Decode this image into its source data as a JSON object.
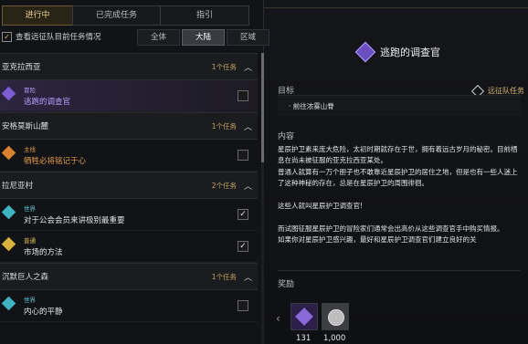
{
  "tabs": [
    {
      "label": "进行中",
      "active": true
    },
    {
      "label": "已完成任务",
      "active": false
    },
    {
      "label": "指引",
      "active": false
    }
  ],
  "option": {
    "label": "查看远征队目前任务情况",
    "checked": true,
    "mark": "✓"
  },
  "filters": [
    {
      "label": "全体",
      "active": false
    },
    {
      "label": "大陆",
      "active": true
    },
    {
      "label": "区域",
      "active": false
    }
  ],
  "regions": [
    {
      "name": "亚克拉西亚",
      "count": "1个任务",
      "chevron": "︿",
      "quests": [
        {
          "type": "冒险",
          "name": "逃跑的调查官",
          "color": "#b99cff",
          "typeColor": "#b99cff",
          "checked": false,
          "selected": true,
          "icon": "diamond-purple"
        }
      ]
    },
    {
      "name": "安格莫斯山麓",
      "count": "1个任务",
      "chevron": "︿",
      "quests": [
        {
          "type": "主线",
          "name": "牺牲必将铭记于心",
          "color": "#e39b4c",
          "typeColor": "#e39b4c",
          "checked": false,
          "selected": false,
          "icon": "diamond-orange"
        }
      ]
    },
    {
      "name": "拉尼亚村",
      "count": "2个任务",
      "chevron": "︿",
      "quests": [
        {
          "type": "世界",
          "name": "对于公会会员来讲极别最重要",
          "color": "#e2e2e2",
          "typeColor": "#63c9d6",
          "checked": true,
          "selected": false,
          "icon": "diamond-cyan"
        },
        {
          "type": "普通",
          "name": "市场的方法",
          "color": "#e2e2e2",
          "typeColor": "#e3c55a",
          "checked": true,
          "selected": false,
          "icon": "diamond-yellow"
        }
      ]
    },
    {
      "name": "沉默巨人之森",
      "count": "1个任务",
      "chevron": "︿",
      "quests": [
        {
          "type": "世界",
          "name": "内心的平静",
          "color": "#e2e2e2",
          "typeColor": "#63c9d6",
          "checked": false,
          "selected": false,
          "icon": "diamond-cyan"
        }
      ]
    }
  ],
  "detail": {
    "title": "逃跑的调查官",
    "goal_label": "目标",
    "goal_tag": "远征队任务",
    "goal_text": "· 前往浓雾山脊",
    "content_label": "内容",
    "content": [
      "星辰护卫素来庞大危险，太初时期就存在于世，拥有着远古岁月的秘密。目前栖息在尚未被征服的亚克拉西亚某处。",
      "普通人就算有一万个胆子也不敢靠近星辰护卫的居住之地，但是也有一些人迷上了这种神秘的存在，总是在星辰护卫的周围徘徊。",
      "",
      "这些人就叫星辰护卫调查官!",
      "",
      "而试图征服星辰护卫的冒险家们通常会出高价从这些调查官手中购买情报。",
      "如果你对星辰护卫感兴趣，最好和星辰护卫调查官们建立良好的关"
    ],
    "reward_label": "奖励",
    "rewards": [
      {
        "count": "131",
        "icon": "purple-gem-icon"
      },
      {
        "count": "1,000",
        "icon": "silver-coin-icon"
      }
    ],
    "arrow": "‹"
  }
}
